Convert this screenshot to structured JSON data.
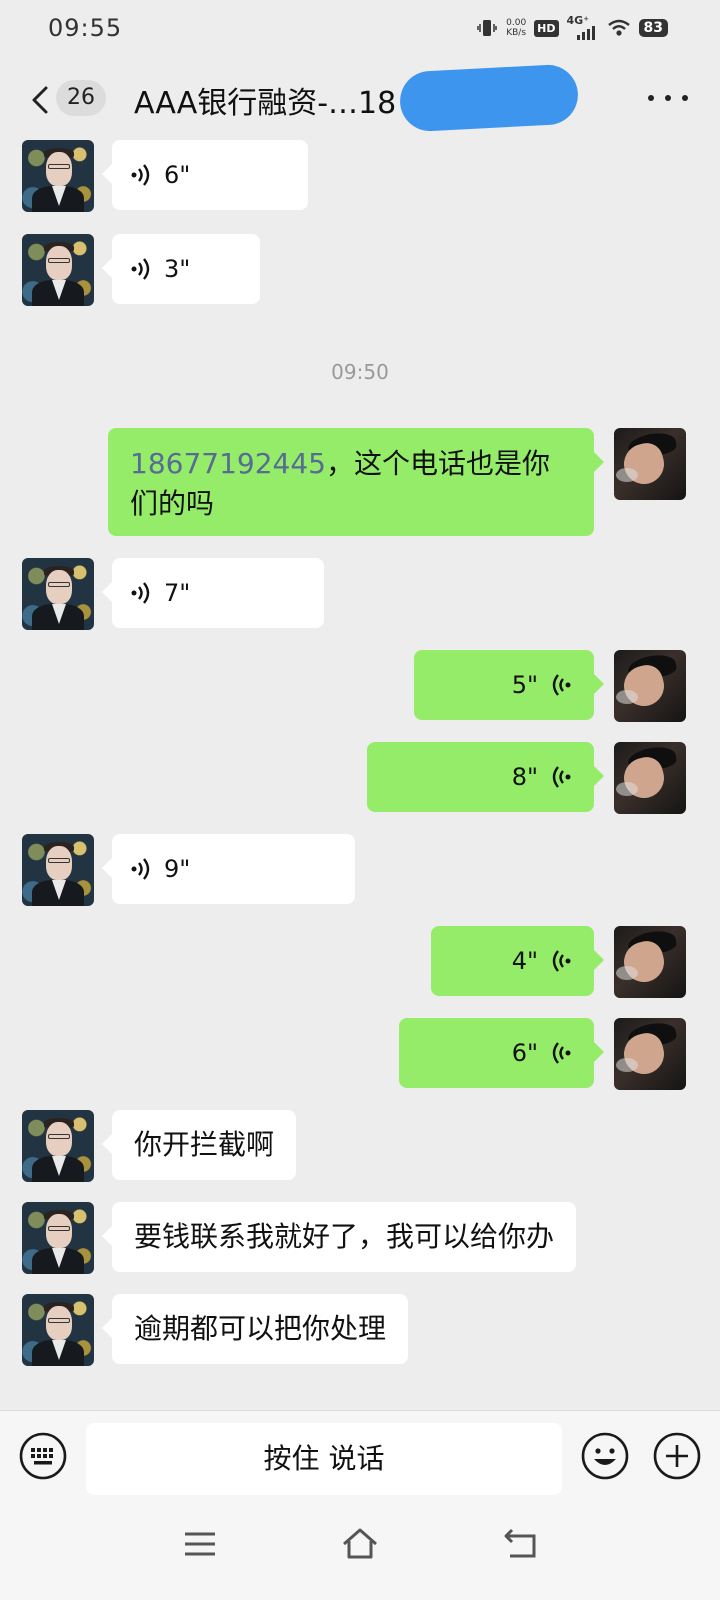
{
  "status_bar": {
    "time": "09:55",
    "net_speed_value": "0.00",
    "net_speed_unit": "KB/s",
    "hd_label": "HD",
    "network_type": "4G⁺",
    "battery": "83"
  },
  "header": {
    "unread_count": "26",
    "title": "AAA银行融资-…18"
  },
  "messages": [
    {
      "side": "in",
      "type": "voice",
      "duration": "6\""
    },
    {
      "side": "in",
      "type": "voice",
      "duration": "3\""
    },
    {
      "type": "timestamp",
      "text": "09:50"
    },
    {
      "side": "out",
      "type": "text",
      "phone": "18677192445",
      "line1_rest": "，这个电话也是你",
      "line2": "们的吗"
    },
    {
      "side": "in",
      "type": "voice",
      "duration": "7\""
    },
    {
      "side": "out",
      "type": "voice",
      "duration": "5\""
    },
    {
      "side": "out",
      "type": "voice",
      "duration": "8\""
    },
    {
      "side": "in",
      "type": "voice",
      "duration": "9\""
    },
    {
      "side": "out",
      "type": "voice",
      "duration": "4\""
    },
    {
      "side": "out",
      "type": "voice",
      "duration": "6\""
    },
    {
      "side": "in",
      "type": "text",
      "text": "你开拦截啊"
    },
    {
      "side": "in",
      "type": "text",
      "text": "要钱联系我就好了，我可以给你办"
    },
    {
      "side": "in",
      "type": "text",
      "text": "逾期都可以把你处理"
    }
  ],
  "input_bar": {
    "hold_to_talk": "按住 说话"
  },
  "colors": {
    "outgoing_bubble": "#95ec69",
    "incoming_bubble": "#ffffff",
    "background": "#ededed",
    "link": "#576b95"
  }
}
